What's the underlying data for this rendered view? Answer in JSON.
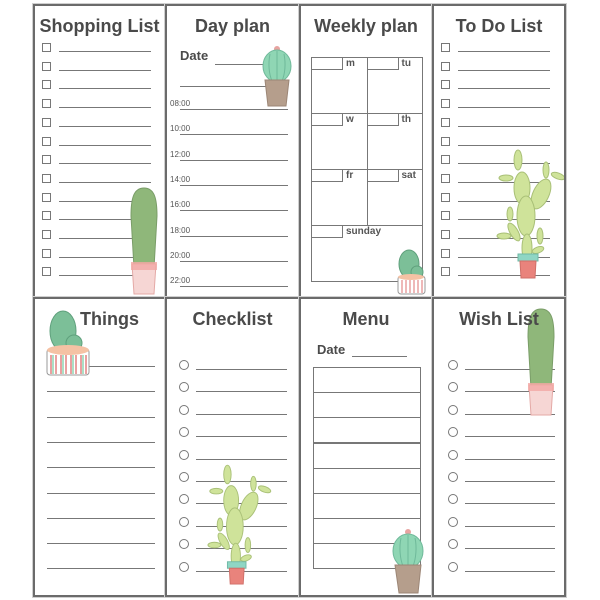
{
  "panels": {
    "shopping": {
      "title": "Shopping List",
      "item_count": 13
    },
    "dayplan": {
      "title": "Day plan",
      "date_label": "Date",
      "times": [
        "08:00",
        "10:00",
        "12:00",
        "14:00",
        "16:00",
        "18:00",
        "20:00",
        "22:00"
      ]
    },
    "weekly": {
      "title": "Weekly plan",
      "days": [
        "m",
        "tu",
        "w",
        "th",
        "fr",
        "sat",
        "sunday"
      ]
    },
    "todo": {
      "title": "To Do List",
      "item_count": 13
    },
    "things": {
      "title": "Things",
      "line_count": 9
    },
    "checklist": {
      "title": "Checklist",
      "item_count": 10
    },
    "menu": {
      "title": "Menu",
      "date_label": "Date",
      "row_count": 8
    },
    "wishlist": {
      "title": "Wish List",
      "item_count": 10
    }
  },
  "icons": [
    "cactus-tall-icon",
    "cactus-round-icon",
    "cactus-barrel-icon",
    "cactus-branching-icon"
  ],
  "colors": {
    "border": "#6b6b6b",
    "text": "#4a4a4a",
    "line": "#777777",
    "cactus_green": "#8fb77a",
    "cactus_mint": "#8fd6b4",
    "cactus_lime": "#cfe39a",
    "pot_pink": "#f2b3b0",
    "pot_brown": "#b59e8c",
    "pot_coral": "#e9837c"
  }
}
